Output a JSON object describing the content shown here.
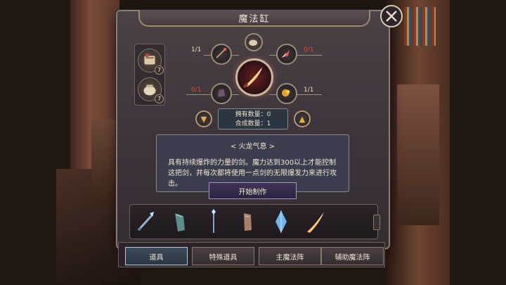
{
  "window": {
    "title": "魔法缸"
  },
  "close": {
    "label": "close"
  },
  "side_ingredients": [
    {
      "icon": "scroll-bundle-icon",
      "count": "7"
    },
    {
      "icon": "pouch-icon",
      "count": "7"
    }
  ],
  "ratios": {
    "top_left": "1/1",
    "top_right": "0/1",
    "bottom_left": "0/1",
    "bottom_right": "1/1"
  },
  "counts": {
    "owned": "拥有数量：0",
    "crafted": "合成数量：1"
  },
  "description": {
    "title": "< 火龙气息 >",
    "line1": "具有持续爆炸的力量的剑。魔力达到300以上才能控制",
    "line2": "这把剑，并每次都将使用一点剑的无限爆发力来进行攻",
    "line3": "击。"
  },
  "start_button": "开始制作",
  "items": [
    {
      "icon": "frost-dagger-icon"
    },
    {
      "icon": "jade-gauntlet-icon"
    },
    {
      "icon": "ice-staff-icon"
    },
    {
      "icon": "leather-glove-icon"
    },
    {
      "icon": "blue-crystal-icon"
    },
    {
      "icon": "fire-sword-icon"
    }
  ],
  "tabs": [
    {
      "label": "道具",
      "active": true
    },
    {
      "label": "特殊道具",
      "active": false
    },
    {
      "label": "主魔法阵",
      "active": false
    },
    {
      "label": "辅助魔法阵",
      "active": false
    }
  ],
  "colors": {
    "ratio_missing": "#e04a3c",
    "ratio_ok": "#e8dcc7",
    "arrow": "#e6b04c",
    "active_tab_border": "#b8c5d4"
  }
}
